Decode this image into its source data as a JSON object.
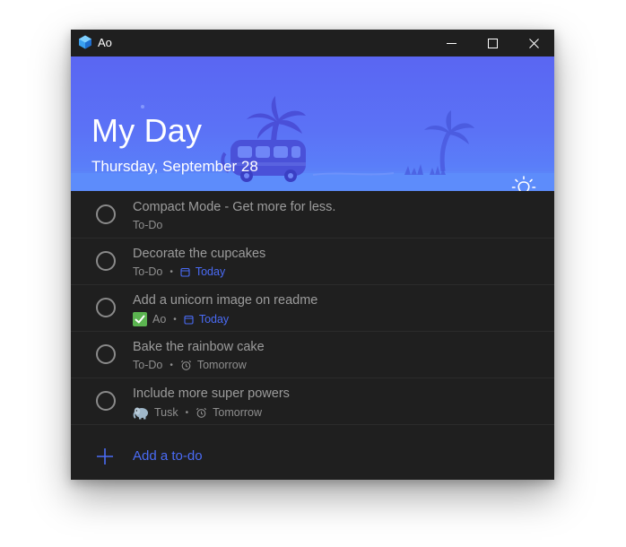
{
  "window": {
    "title": "Ao"
  },
  "header": {
    "title": "My Day",
    "date": "Thursday, September 28"
  },
  "tasks": [
    {
      "title": "Compact Mode - Get more for less.",
      "list": "To-Do"
    },
    {
      "title": "Decorate the cupcakes",
      "list": "To-Do",
      "due": "Today"
    },
    {
      "title": "Add a unicorn image on readme",
      "list": "Ao",
      "list_icon": "check-mark-icon",
      "due": "Today"
    },
    {
      "title": "Bake the rainbow cake",
      "list": "To-Do",
      "reminder": "Tomorrow"
    },
    {
      "title": "Include more super powers",
      "list": "Tusk",
      "list_icon": "elephant-icon",
      "reminder": "Tomorrow"
    }
  ],
  "add_task": {
    "label": "Add a to-do"
  },
  "colors": {
    "accent": "#4a6bf5",
    "window_bg": "#1f1f1f",
    "header_gradient_top": "#5a66f2",
    "header_gradient_bottom": "#5a86fb"
  }
}
